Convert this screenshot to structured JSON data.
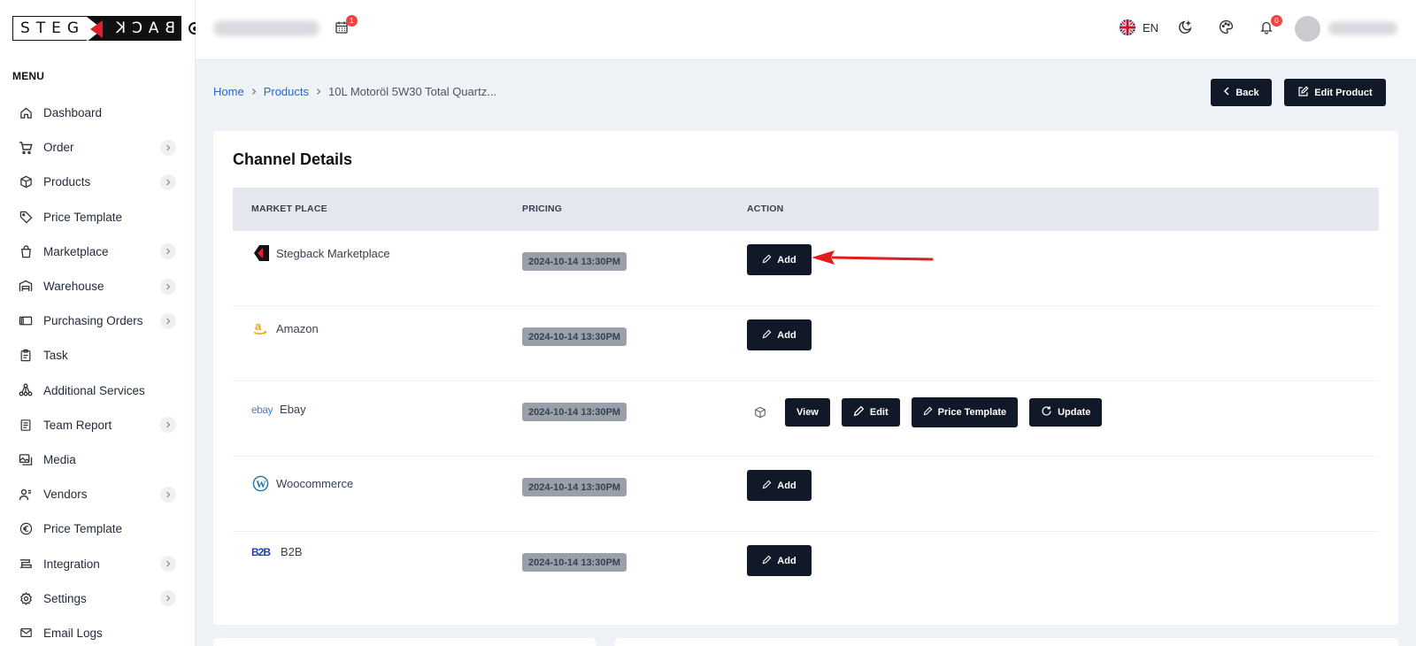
{
  "brand": {
    "left_text": "STEG",
    "right_text": "BACK"
  },
  "sidebar": {
    "menu_title": "MENU",
    "items": [
      {
        "label": "Dashboard",
        "icon": "home-icon",
        "expandable": false
      },
      {
        "label": "Order",
        "icon": "cart-icon",
        "expandable": true
      },
      {
        "label": "Products",
        "icon": "box-icon",
        "expandable": true
      },
      {
        "label": "Price Template",
        "icon": "tag-icon",
        "expandable": false
      },
      {
        "label": "Marketplace",
        "icon": "bag-icon",
        "expandable": true
      },
      {
        "label": "Warehouse",
        "icon": "warehouse-icon",
        "expandable": true
      },
      {
        "label": "Purchasing Orders",
        "icon": "cards-icon",
        "expandable": true
      },
      {
        "label": "Task",
        "icon": "clipboard-icon",
        "expandable": false
      },
      {
        "label": "Additional Services",
        "icon": "network-icon",
        "expandable": false
      },
      {
        "label": "Team Report",
        "icon": "report-icon",
        "expandable": true
      },
      {
        "label": "Media",
        "icon": "media-icon",
        "expandable": false
      },
      {
        "label": "Vendors",
        "icon": "users-icon",
        "expandable": true
      },
      {
        "label": "Price Template",
        "icon": "euro-icon",
        "expandable": false
      },
      {
        "label": "Integration",
        "icon": "integration-icon",
        "expandable": true
      },
      {
        "label": "Settings",
        "icon": "gear-icon",
        "expandable": true
      },
      {
        "label": "Email Logs",
        "icon": "mail-icon",
        "expandable": false
      }
    ]
  },
  "topbar": {
    "calendar_badge": "1",
    "language": "EN",
    "notifications_badge": "0"
  },
  "breadcrumb": {
    "home": "Home",
    "products": "Products",
    "current": "10L Motoröl 5W30 Total Quartz..."
  },
  "header_actions": {
    "back_label": "Back",
    "edit_label": "Edit Product"
  },
  "card": {
    "title": "Channel Details",
    "columns": [
      "MARKET PLACE",
      "PRICING",
      "ACTION"
    ],
    "rows": [
      {
        "name": "Stegback Marketplace",
        "logo": "stegback-logo",
        "pricing": "2024-10-14 13:30PM",
        "action": "Add"
      },
      {
        "name": "Amazon",
        "logo": "amazon-logo",
        "pricing": "2024-10-14 13:30PM",
        "action": "Add"
      },
      {
        "name": "Ebay",
        "logo": "ebay-logo",
        "pricing": "2024-10-14 13:30PM",
        "actions": [
          "View",
          "Edit",
          "Price Template",
          "Update"
        ]
      },
      {
        "name": "Woocommerce",
        "logo": "wordpress-logo",
        "pricing": "2024-10-14 13:30PM",
        "action": "Add"
      },
      {
        "name": "B2B",
        "logo": "b2b-logo",
        "pricing": "2024-10-14 13:30PM",
        "action": "Add"
      }
    ],
    "ebay_logo_text": "ebay",
    "b2b_logo_text": "B2B"
  },
  "colors": {
    "primary_dark": "#111827",
    "link": "#2563eb",
    "badge": "#ef4444",
    "arrow": "#e11d1d"
  }
}
